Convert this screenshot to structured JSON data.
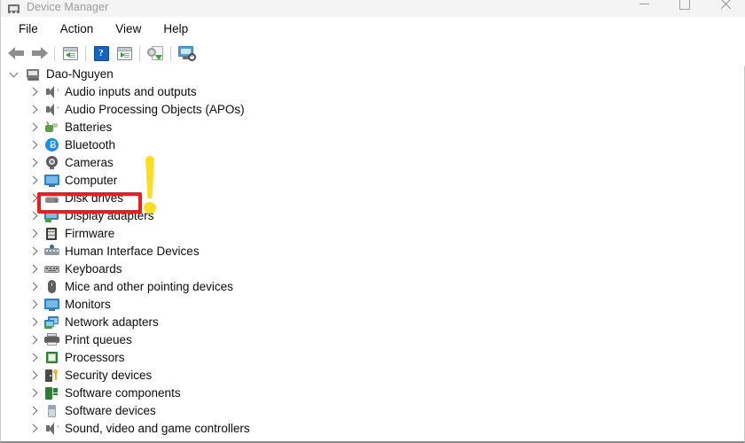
{
  "window": {
    "title": "Device Manager",
    "icon": "device-manager-icon",
    "controls": {
      "minimize": "minimize",
      "maximize": "maximize",
      "close": "close"
    }
  },
  "menubar": {
    "items": [
      {
        "label": "File"
      },
      {
        "label": "Action"
      },
      {
        "label": "View"
      },
      {
        "label": "Help"
      }
    ]
  },
  "toolbar": {
    "buttons": [
      {
        "name": "back-button",
        "icon": "back-arrow-icon"
      },
      {
        "name": "forward-button",
        "icon": "forward-arrow-icon"
      },
      {
        "name": "properties-button",
        "icon": "properties-icon"
      },
      {
        "name": "help-button",
        "icon": "help-question-icon",
        "glyph": "?"
      },
      {
        "name": "show-hidden-devices-button",
        "icon": "show-hidden-devices-icon"
      },
      {
        "name": "update-driver-button",
        "icon": "update-driver-icon"
      },
      {
        "name": "scan-hardware-changes-button",
        "icon": "scan-hardware-icon"
      }
    ]
  },
  "tree": {
    "root": {
      "label": "Dao-Nguyen",
      "icon": "computer-icon",
      "expanded": true
    },
    "items": [
      {
        "label": "Audio inputs and outputs",
        "icon": "speaker-icon"
      },
      {
        "label": "Audio Processing Objects (APOs)",
        "icon": "speaker-icon"
      },
      {
        "label": "Batteries",
        "icon": "battery-icon"
      },
      {
        "label": "Bluetooth",
        "icon": "bluetooth-icon"
      },
      {
        "label": "Cameras",
        "icon": "camera-icon"
      },
      {
        "label": "Computer",
        "icon": "monitor-icon"
      },
      {
        "label": "Disk drives",
        "icon": "disk-drive-icon"
      },
      {
        "label": "Display adapters",
        "icon": "display-adapter-icon"
      },
      {
        "label": "Firmware",
        "icon": "firmware-icon"
      },
      {
        "label": "Human Interface Devices",
        "icon": "hid-icon"
      },
      {
        "label": "Keyboards",
        "icon": "keyboard-icon"
      },
      {
        "label": "Mice and other pointing devices",
        "icon": "mouse-icon"
      },
      {
        "label": "Monitors",
        "icon": "monitor-icon"
      },
      {
        "label": "Network adapters",
        "icon": "network-adapter-icon"
      },
      {
        "label": "Print queues",
        "icon": "printer-icon"
      },
      {
        "label": "Processors",
        "icon": "processor-icon"
      },
      {
        "label": "Security devices",
        "icon": "security-device-icon"
      },
      {
        "label": "Software components",
        "icon": "software-component-icon"
      },
      {
        "label": "Software devices",
        "icon": "software-device-icon"
      },
      {
        "label": "Sound, video and game controllers",
        "icon": "speaker-icon"
      }
    ]
  },
  "annotations": {
    "highlight_target": "Disk drives",
    "highlight_color": "#ee1c1c",
    "pointer_color": "#fcdd23",
    "pointer_shape": "exclamation-mark"
  }
}
